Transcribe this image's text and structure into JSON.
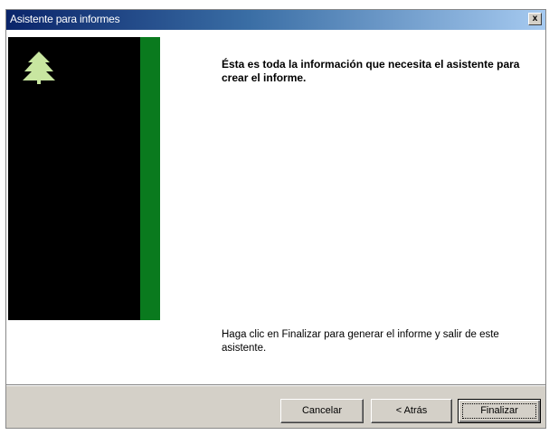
{
  "window": {
    "title": "Asistente para informes",
    "close_label": "x"
  },
  "content": {
    "heading": "Ésta es toda la información que necesita el asistente para crear el informe.",
    "footer": "Haga clic en Finalizar para generar el informe y salir de este asistente."
  },
  "buttons": {
    "cancel": "Cancelar",
    "back": "< Atrás",
    "finish": "Finalizar"
  },
  "colors": {
    "side_panel": "#000000",
    "green_strip": "#0a7a1e",
    "tree_icon": "#c8e6a0"
  },
  "icons": {
    "tree": "tree-icon",
    "close": "close-icon"
  }
}
